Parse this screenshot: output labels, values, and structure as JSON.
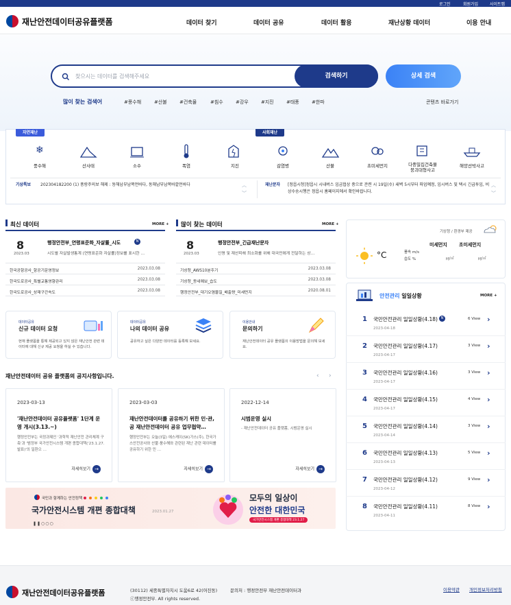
{
  "topbar": {
    "login": "로그인",
    "signup": "회원가입",
    "sitemap": "사이트맵"
  },
  "header": {
    "logo_text": "재난안전데이터공유플랫폼",
    "nav": [
      "데이터 찾기",
      "데이터 공유",
      "데이터 활용",
      "재난상황 데이터",
      "이용 안내"
    ]
  },
  "search": {
    "placeholder": "찾으시는 데이터를 검색해주세요",
    "button": "검색하기",
    "detail_button": "상세 검색",
    "popular_label": "많이 찾는 검색어",
    "keywords": [
      "#풍수해",
      "#산불",
      "#건축물",
      "#침수",
      "#강우",
      "#지진",
      "#태풍",
      "#한파"
    ],
    "contents_link": "콘텐츠 바로가기"
  },
  "categories": {
    "natural_tag": "자연재난",
    "social_tag": "사회재난",
    "items": [
      "풍수해",
      "산사태",
      "소수",
      "폭염",
      "지진",
      "감염병",
      "산불",
      "초미세먼지",
      "다중밀집건축물\n붕괴대형사고",
      "해양선박사고"
    ]
  },
  "alerts": {
    "weather_label": "기상특보",
    "weather_text": "202304182200 (1) 풍랑주의보 해제 : 동해남부남쪽먼바다, 동해남부남쪽바깥먼바다",
    "disaster_label": "재난문자",
    "disaster_text": "[정읍시청]정읍시 시내버스 임금협상 중으로 관련 시 19일(수) 새벽 5시부터 파업예정, 임시버스 및 택시 긴급투입, 비상수송시행은 정읍시 홈페이지에서 확인바랍니다."
  },
  "latest": {
    "title": "최신 데이터",
    "more": "MORE +",
    "feature_day": "8",
    "feature_ym": "2023.03",
    "feature_title": "행정안전부_연령표준화_자살률_시도",
    "feature_desc": "시도별 자살발생통계 (연령표준화 자살률)정보를 표시한 …",
    "rows": [
      {
        "t": "한국공항공사_항공기운영정보",
        "d": "2023.03.08"
      },
      {
        "t": "한국도로공사_특별교통영향관리",
        "d": "2023.03.08"
      },
      {
        "t": "한국도로공사_상재구간속도",
        "d": "2023.03.08"
      }
    ]
  },
  "popular": {
    "title": "많이 찾는 데이터",
    "more": "MORE +",
    "feature_day": "8",
    "feature_ym": "2023.03",
    "feature_title": "행정안전부_긴급재난문자",
    "feature_desc": "인명 및 재산피해 최소화를 위해 대국민에게 전달하는 상…",
    "rows": [
      {
        "t": "기상청_AWS10분주기",
        "d": "2023.03.08"
      },
      {
        "t": "기상청_동네예보_습도",
        "d": "2023.03.08"
      },
      {
        "t": "행정안전부_대기오염물질_배출량_미세먼지",
        "d": "2020.08.01"
      }
    ]
  },
  "weather": {
    "caption": "기상청 / 환경부 제공",
    "unit": "°C",
    "fine_dust": "미세먼지",
    "ultra_fine_dust": "초미세먼지",
    "wind": "풍속 m/s",
    "humidity": "습도 %",
    "fine_val": "㎍/㎥",
    "ultra_val": "㎍/㎥"
  },
  "services": [
    {
      "tag": "데이터공유",
      "title": "신규 데이터 요청",
      "desc": "현재 플랫폼을 통해 제공되고 있지 않은 재난안전 관련 데이터에 대해 신규 제공 요청을 하실 수 있습니다."
    },
    {
      "tag": "데이터공유",
      "title": "나의 데이터 공유",
      "desc": "공유하고 싶은 다양한 데이터를 등록해 보세요."
    },
    {
      "tag": "이용안내",
      "title": "문의하기",
      "desc": "재난안전데이터 공유 플랫폼의 이용방법을 문의해 보세요."
    }
  ],
  "notices": {
    "heading": "재난안전데이터 공유 플랫폼의 공지사항입니다.",
    "more_label": "자세히보기",
    "items": [
      {
        "date": "2023-03-13",
        "title": "'재난안전데이터 공유플랫폼' 1단계 운영 개시(3.13.~)",
        "desc": "행정안전부는 국정과제인 '과학적 재난안전 관리체계 구축'과 '범정부 국가안전시스템 개편 종합대책('23.1.27.발표)'의 일환으 …"
      },
      {
        "date": "2023-03-03",
        "title": "재난안전데이터를 공유하기 위한 민·관, 공 재난안전데이터 공유 업무협약…",
        "desc": "행정안전부는 오늘(3일) 에스케이(SK)가스(주), 한국가스안전공사와 산불·풍수해와 관련된 재난 관련 데이터를 공유하기 위한 민 …"
      },
      {
        "date": "2022-12-14",
        "title": "시범운영 실시",
        "desc": "- 재난안전데이터 공유 플랫폼, 시범운영 실시"
      }
    ]
  },
  "banner": {
    "small": "국민과 함께하는 안전정책",
    "main": "국가안전시스템 개편 종합대책",
    "date": "2023.01.27",
    "slogan1": "모두의 일상이",
    "slogan2": "안전한 대한민국",
    "badge": "국가안전시스템 개편 종합대책 23.1.27"
  },
  "safety": {
    "title_accent": "안전관리",
    "title_rest": " 일일상황",
    "more": "MORE +",
    "items": [
      {
        "n": "1",
        "t": "국민안전관리 일일상황(4.18)",
        "d": "2023-04-18",
        "v": "6 View",
        "new": true
      },
      {
        "n": "2",
        "t": "국민안전관리 일일상황(4.17)",
        "d": "2023-04-17",
        "v": "3 View",
        "new": false
      },
      {
        "n": "3",
        "t": "국민안전관리 일일상황(4.16)",
        "d": "2023-04-17",
        "v": "3 View",
        "new": false
      },
      {
        "n": "4",
        "t": "국민안전관리 일일상황(4.15)",
        "d": "2023-04-17",
        "v": "4 View",
        "new": false
      },
      {
        "n": "5",
        "t": "국민안전관리 일일상황(4.14)",
        "d": "2023-04-14",
        "v": "3 View",
        "new": false
      },
      {
        "n": "6",
        "t": "국민안전관리 일일상황(4.13)",
        "d": "2023-04-13",
        "v": "5 View",
        "new": false
      },
      {
        "n": "7",
        "t": "국민안전관리 일일상황(4.12)",
        "d": "2023-04-12",
        "v": "9 View",
        "new": false
      },
      {
        "n": "8",
        "t": "국민안전관리 일일상황(4.11)",
        "d": "2023-04-11",
        "v": "8 View",
        "new": false
      }
    ]
  },
  "footer": {
    "logo_text": "재난안전데이터공유플랫폼",
    "address": "(30112) 세종특별자치시 도움6로 42(어진동)",
    "contact": "문의처 : 행정안전부 재난안전데이터과",
    "copyright": "ⓒ행정안전부. All rights reserved.",
    "terms": "이용약관",
    "privacy": "개인정보처리방침"
  },
  "colors": {
    "primary": "#1e3a8a",
    "accent": "#3b82f6",
    "natural_tag": "#3b5bdb",
    "social_tag": "#1e3a8a"
  }
}
